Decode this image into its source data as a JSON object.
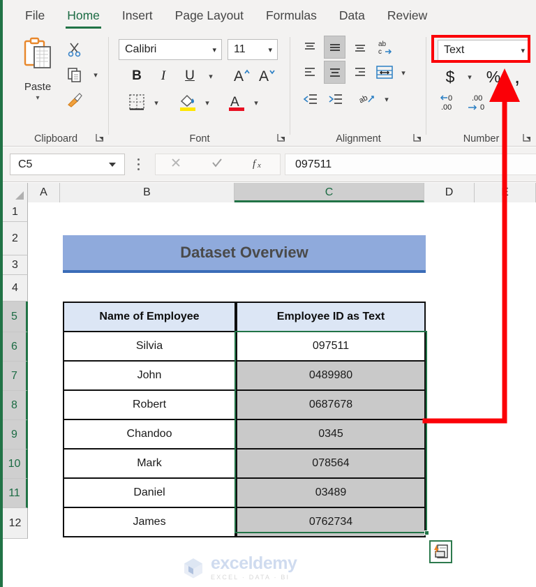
{
  "ribbon": {
    "tabs": [
      {
        "label": "File",
        "active": false
      },
      {
        "label": "Home",
        "active": true
      },
      {
        "label": "Insert",
        "active": false
      },
      {
        "label": "Page Layout",
        "active": false
      },
      {
        "label": "Formulas",
        "active": false
      },
      {
        "label": "Data",
        "active": false
      },
      {
        "label": "Review",
        "active": false
      }
    ],
    "groups": {
      "clipboard": {
        "label": "Clipboard",
        "paste_label": "Paste"
      },
      "font": {
        "label": "Font",
        "font_name": "Calibri",
        "font_size": "11",
        "bold": "B",
        "italic": "I",
        "underline": "U"
      },
      "alignment": {
        "label": "Alignment"
      },
      "number": {
        "label": "Number",
        "format_value": "Text",
        "currency": "$",
        "percent": "%",
        "comma": ","
      }
    },
    "accent_green": "#217346",
    "highlight_red": "#fb0007"
  },
  "formula_bar": {
    "name_box": "C5",
    "cancel_icon": "cancel-icon",
    "confirm_icon": "confirm-icon",
    "function_icon": "fx",
    "value": "097511"
  },
  "sheet": {
    "columns": [
      {
        "label": "A",
        "selected": false
      },
      {
        "label": "B",
        "selected": false
      },
      {
        "label": "C",
        "selected": true
      },
      {
        "label": "D",
        "selected": false
      },
      {
        "label": "E",
        "selected": false
      }
    ],
    "rows": [
      {
        "label": "1",
        "selected": false
      },
      {
        "label": "2",
        "selected": false
      },
      {
        "label": "3",
        "selected": false
      },
      {
        "label": "4",
        "selected": false
      },
      {
        "label": "5",
        "selected": true
      },
      {
        "label": "6",
        "selected": true
      },
      {
        "label": "7",
        "selected": true
      },
      {
        "label": "8",
        "selected": true
      },
      {
        "label": "9",
        "selected": true
      },
      {
        "label": "10",
        "selected": true
      },
      {
        "label": "11",
        "selected": true
      },
      {
        "label": "12",
        "selected": false
      }
    ],
    "banner_title": "Dataset Overview",
    "banner_color": "#8faadc",
    "table": {
      "headers": [
        "Name of Employee",
        "Employee ID as Text"
      ],
      "rows": [
        {
          "name": "Silvia",
          "id": "097511",
          "shaded": false
        },
        {
          "name": "John",
          "id": "0489980",
          "shaded": true
        },
        {
          "name": "Robert",
          "id": "0687678",
          "shaded": true
        },
        {
          "name": "Chandoo",
          "id": "0345",
          "shaded": true
        },
        {
          "name": "Mark",
          "id": "078564",
          "shaded": true
        },
        {
          "name": "Daniel",
          "id": "03489",
          "shaded": true
        },
        {
          "name": "James",
          "id": "0762734",
          "shaded": true
        }
      ]
    },
    "paste_options_icon": "paste-options-icon",
    "selection_color": "#217346"
  },
  "watermark": {
    "name": "exceldemy",
    "tagline": "EXCEL · DATA · BI"
  }
}
